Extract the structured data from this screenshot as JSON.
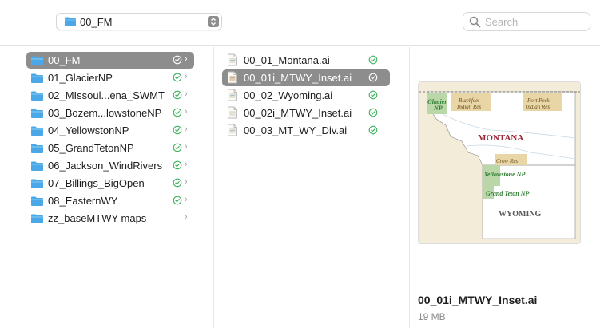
{
  "toolbar": {
    "path_popup_label": "00_FM",
    "search_placeholder": "Search"
  },
  "column1": {
    "items": [
      {
        "name": "00_FM",
        "selected": true,
        "synced": true
      },
      {
        "name": "01_GlacierNP",
        "selected": false,
        "synced": true
      },
      {
        "name": "02_MIssoul...ena_SWMT",
        "selected": false,
        "synced": true
      },
      {
        "name": "03_Bozem...lowstoneNP",
        "selected": false,
        "synced": true
      },
      {
        "name": "04_YellowstonNP",
        "selected": false,
        "synced": true
      },
      {
        "name": "05_GrandTetonNP",
        "selected": false,
        "synced": true
      },
      {
        "name": "06_Jackson_WindRivers",
        "selected": false,
        "synced": true
      },
      {
        "name": "07_Billings_BigOpen",
        "selected": false,
        "synced": true
      },
      {
        "name": "08_EasternWY",
        "selected": false,
        "synced": true
      },
      {
        "name": "zz_baseMTWY maps",
        "selected": false,
        "synced": false
      }
    ]
  },
  "column2": {
    "items": [
      {
        "name": "00_01_Montana.ai",
        "selected": false
      },
      {
        "name": "00_01i_MTWY_Inset.ai",
        "selected": true
      },
      {
        "name": "00_02_Wyoming.ai",
        "selected": false
      },
      {
        "name": "00_02i_MTWY_Inset.ai",
        "selected": false
      },
      {
        "name": "00_03_MT_WY_Div.ai",
        "selected": false
      }
    ]
  },
  "preview": {
    "file_name": "00_01i_MTWY_Inset.ai",
    "file_size": "19 MB",
    "map_labels": {
      "glacier": "Glacier",
      "glacier_np": "NP",
      "blackfeet": "Blackfeet",
      "blackfeet_res": "Indian Res",
      "fort_peck": "Fort Peck",
      "fort_peck_res": "Indian Res",
      "montana": "MONTANA",
      "crow_res": "Crow Res",
      "yellowstone": "Yellowstone NP",
      "grand_teton": "Grand Teton NP",
      "wyoming": "WYOMING"
    }
  },
  "colors": {
    "folder_blue": "#4aa8e8",
    "selection_gray": "#8d8d8d",
    "sync_green": "#3bb15a",
    "state_label_red": "#9b2335",
    "park_green": "#2e7d32"
  }
}
